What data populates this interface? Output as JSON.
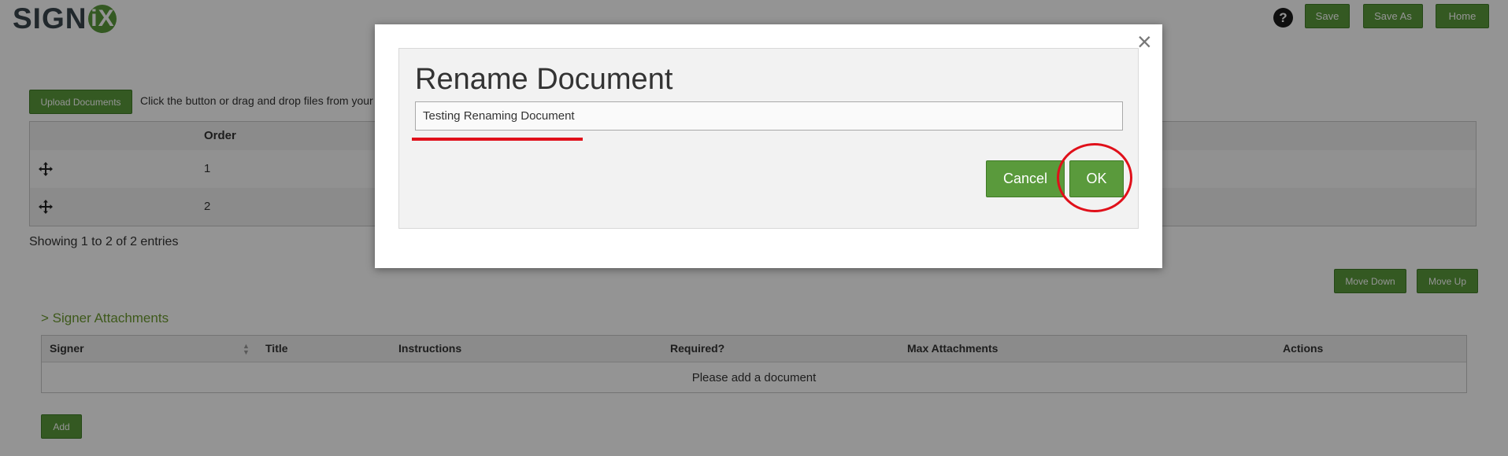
{
  "header": {
    "logo_text": "SIGN",
    "logo_mark": "iX",
    "help_label": "?",
    "save_label": "Save",
    "save_as_label": "Save As",
    "home_label": "Home"
  },
  "upload": {
    "button_label": "Upload Documents",
    "hint": "Click the button or drag and drop files from your d"
  },
  "documents_table": {
    "columns": [
      "Order"
    ],
    "rows": [
      {
        "order": "1"
      },
      {
        "order": "2"
      }
    ],
    "footer": "Showing 1 to 2 of 2 entries"
  },
  "row_actions": {
    "move_down_label": "Move Down",
    "move_up_label": "Move Up"
  },
  "attachments": {
    "title": "> Signer Attachments",
    "columns": [
      "Signer",
      "Title",
      "Instructions",
      "Required?",
      "Max Attachments",
      "Actions"
    ],
    "empty_message": "Please add a document",
    "add_label": "Add"
  },
  "dialog": {
    "title": "Rename Document",
    "input_value": "Testing Renaming Document",
    "cancel_label": "Cancel",
    "ok_label": "OK",
    "close_label": "×"
  },
  "annotation_color": "#e0101a",
  "accent_color": "#5a9a3c"
}
